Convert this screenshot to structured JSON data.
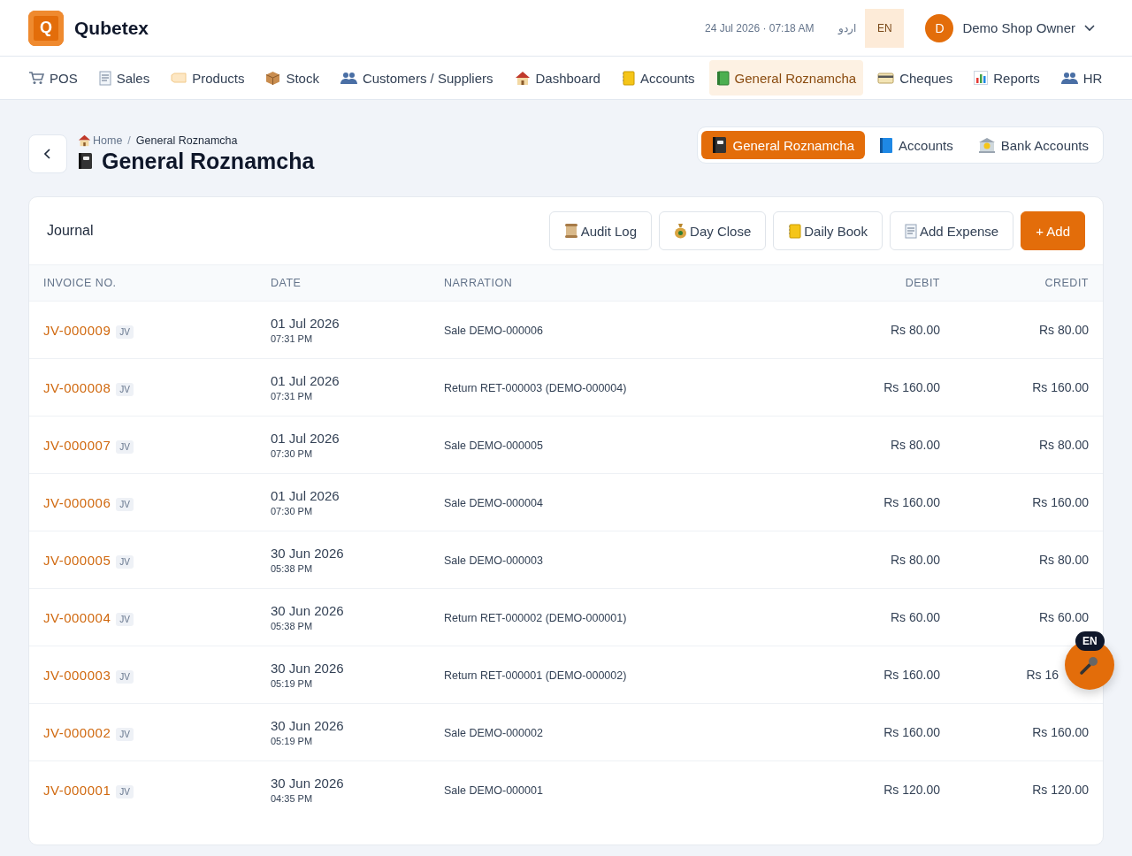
{
  "header": {
    "logo_letter": "Q",
    "brand": "Qubetex",
    "datetime": "24 Jul 2026 · 07:18 AM",
    "languages": [
      {
        "label": "اردو",
        "selected": false
      },
      {
        "label": "EN",
        "selected": true
      }
    ],
    "user": {
      "initial": "D",
      "name": "Demo Shop Owner"
    }
  },
  "nav": [
    {
      "label": "POS",
      "selected": false
    },
    {
      "label": "Sales",
      "selected": false
    },
    {
      "label": "Products",
      "selected": false
    },
    {
      "label": "Stock",
      "selected": false
    },
    {
      "label": "Customers / Suppliers",
      "selected": false
    },
    {
      "label": "Dashboard",
      "selected": false
    },
    {
      "label": "Accounts",
      "selected": false
    },
    {
      "label": "General Roznamcha",
      "selected": true
    },
    {
      "label": "Cheques",
      "selected": false
    },
    {
      "label": "Reports",
      "selected": false
    },
    {
      "label": "HR",
      "selected": false
    }
  ],
  "breadcrumb": [
    "Home",
    "/",
    "General Roznamcha"
  ],
  "page_title": "General Roznamcha",
  "view_tabs": [
    {
      "label": "General Roznamcha",
      "selected": true
    },
    {
      "label": "Accounts",
      "selected": false
    },
    {
      "label": "Bank Accounts",
      "selected": false
    }
  ],
  "journal": {
    "title": "Journal",
    "actions": [
      {
        "label": "Audit Log",
        "kind": "secondary"
      },
      {
        "label": "Day Close",
        "kind": "secondary"
      },
      {
        "label": "Daily Book",
        "kind": "secondary"
      },
      {
        "label": "Add Expense",
        "kind": "secondary"
      },
      {
        "label": "+ Add",
        "kind": "primary"
      }
    ],
    "columns": [
      "INVOICE NO.",
      "DATE",
      "NARRATION",
      "DEBIT",
      "CREDIT"
    ],
    "rows": [
      {
        "invoice": "JV-000009",
        "type": "JV",
        "date": "01 Jul 2026",
        "time": "07:31 PM",
        "narration": "Sale DEMO-000006",
        "debit": "Rs 80.00",
        "credit": "Rs 80.00"
      },
      {
        "invoice": "JV-000008",
        "type": "JV",
        "date": "01 Jul 2026",
        "time": "07:31 PM",
        "narration": "Return RET-000003 (DEMO-000004)",
        "debit": "Rs 160.00",
        "credit": "Rs 160.00"
      },
      {
        "invoice": "JV-000007",
        "type": "JV",
        "date": "01 Jul 2026",
        "time": "07:30 PM",
        "narration": "Sale DEMO-000005",
        "debit": "Rs 80.00",
        "credit": "Rs 80.00"
      },
      {
        "invoice": "JV-000006",
        "type": "JV",
        "date": "01 Jul 2026",
        "time": "07:30 PM",
        "narration": "Sale DEMO-000004",
        "debit": "Rs 160.00",
        "credit": "Rs 160.00"
      },
      {
        "invoice": "JV-000005",
        "type": "JV",
        "date": "30 Jun 2026",
        "time": "05:38 PM",
        "narration": "Sale DEMO-000003",
        "debit": "Rs 80.00",
        "credit": "Rs 80.00"
      },
      {
        "invoice": "JV-000004",
        "type": "JV",
        "date": "30 Jun 2026",
        "time": "05:38 PM",
        "narration": "Return RET-000002 (DEMO-000001)",
        "debit": "Rs 60.00",
        "credit": "Rs 60.00"
      },
      {
        "invoice": "JV-000003",
        "type": "JV",
        "date": "30 Jun 2026",
        "time": "05:19 PM",
        "narration": "Return RET-000001 (DEMO-000002)",
        "debit": "Rs 160.00",
        "credit": "Rs 16",
        "credit_covered": true
      },
      {
        "invoice": "JV-000002",
        "type": "JV",
        "date": "30 Jun 2026",
        "time": "05:19 PM",
        "narration": "Sale DEMO-000002",
        "debit": "Rs 160.00",
        "credit": "Rs 160.00"
      },
      {
        "invoice": "JV-000001",
        "type": "JV",
        "date": "30 Jun 2026",
        "time": "04:35 PM",
        "narration": "Sale DEMO-000001",
        "debit": "Rs 120.00",
        "credit": "Rs 120.00"
      }
    ]
  },
  "voice_button": {
    "badge": "EN"
  }
}
